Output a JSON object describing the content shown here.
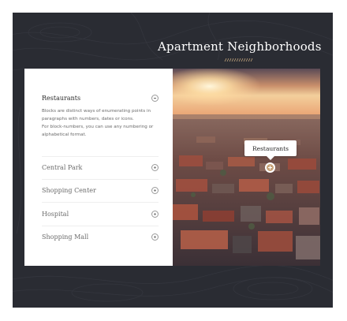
{
  "page": {
    "title": "Apartment Neighborhoods"
  },
  "accordion": {
    "items": [
      {
        "label": "Restaurants",
        "expanded": true,
        "icon": "minus-circle-icon",
        "body": [
          "Blocks are distinct ways of enumerating points in paragraphs with numbers, dates or icons.",
          "For block-numbers, you can use any numbering or alphabetical format."
        ]
      },
      {
        "label": "Central Park",
        "expanded": false,
        "icon": "plus-circle-icon"
      },
      {
        "label": "Shopping Center",
        "expanded": false,
        "icon": "plus-circle-icon"
      },
      {
        "label": "Hospital",
        "expanded": false,
        "icon": "plus-circle-icon"
      },
      {
        "label": "Shopping Mall",
        "expanded": false,
        "icon": "plus-circle-icon"
      }
    ]
  },
  "map": {
    "tooltip": "Restaurants",
    "pin_icon": "plus-pin-icon"
  },
  "colors": {
    "section_bg": "#2a2c33",
    "accent": "#c9a47a",
    "panel_bg": "#ffffff"
  }
}
